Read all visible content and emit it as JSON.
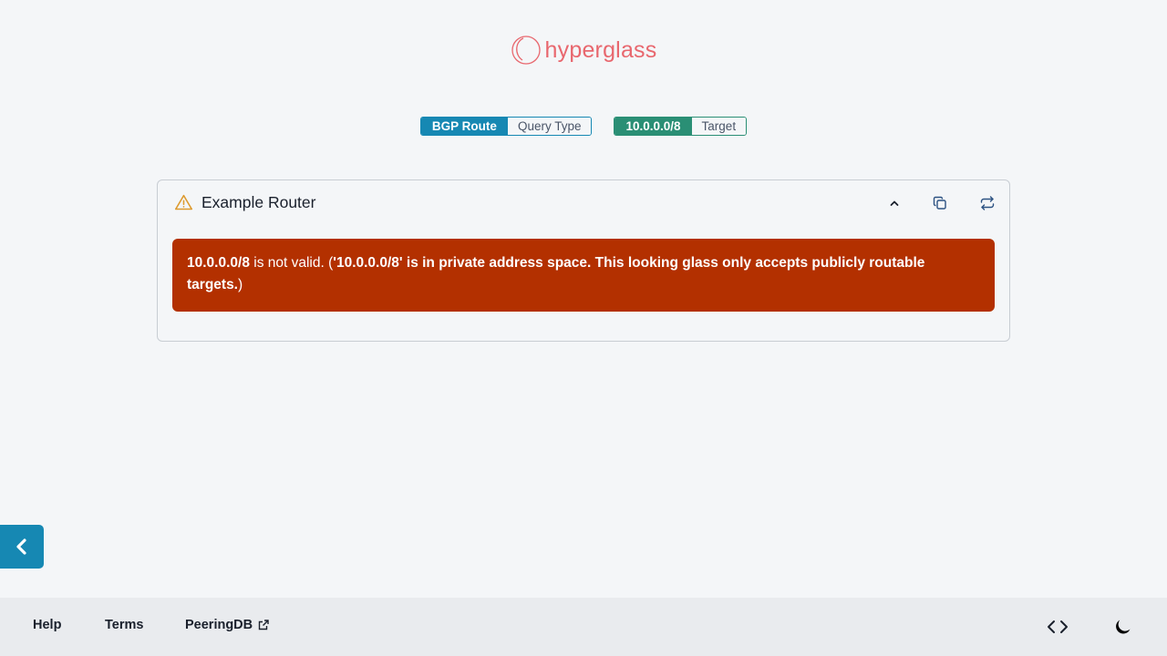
{
  "app": {
    "logo_text": "hyperglass",
    "brand_color": "#e8676e"
  },
  "query": {
    "query_type_value": "BGP Route",
    "query_type_label": "Query Type",
    "target_value": "10.0.0.0/8",
    "target_label": "Target"
  },
  "result": {
    "router_name": "Example Router",
    "status_icon": "warning-icon",
    "error": {
      "target": "10.0.0.0/8",
      "middle": " is not valid. (",
      "detail": "'10.0.0.0/8' is in private address space. This looking glass only accepts publicly routable targets.",
      "end": ")",
      "color": "#b33000"
    },
    "icons": [
      "chevron-up-icon",
      "copy-icon",
      "requery-icon"
    ]
  },
  "footer": {
    "help": "Help",
    "terms": "Terms",
    "peeringdb": "PeeringDB",
    "icons": [
      "external-link-icon",
      "code-icon",
      "moon-icon"
    ]
  },
  "colors": {
    "accent_blue": "#1688b3",
    "accent_green": "#2a8f75",
    "warning": "#dd9a2e",
    "background": "#f4f6f8",
    "footer_bg": "#e9ebee"
  }
}
